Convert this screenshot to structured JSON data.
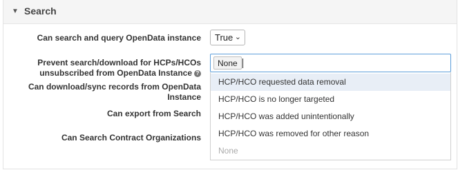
{
  "section": {
    "title": "Search",
    "caret_icon": "triangle-down-icon"
  },
  "fields": {
    "search_query_label": "Can search and query OpenData instance",
    "search_query_value": "True",
    "prevent_label_line1": "Prevent search/download for HCPs/HCOs",
    "prevent_label_line2": "unsubscribed from OpenData Instance",
    "prevent_selected": "None",
    "download_label_line1": "Can download/sync records from OpenData",
    "download_label_line2": "Instance",
    "export_label": "Can export from Search",
    "contract_label": "Can Search Contract Organizations"
  },
  "dropdown": {
    "options": [
      "HCP/HCO requested data removal",
      "HCP/HCO is no longer targeted",
      "HCP/HCO was added unintentionally",
      "HCP/HCO was removed for other reason",
      "None"
    ]
  }
}
